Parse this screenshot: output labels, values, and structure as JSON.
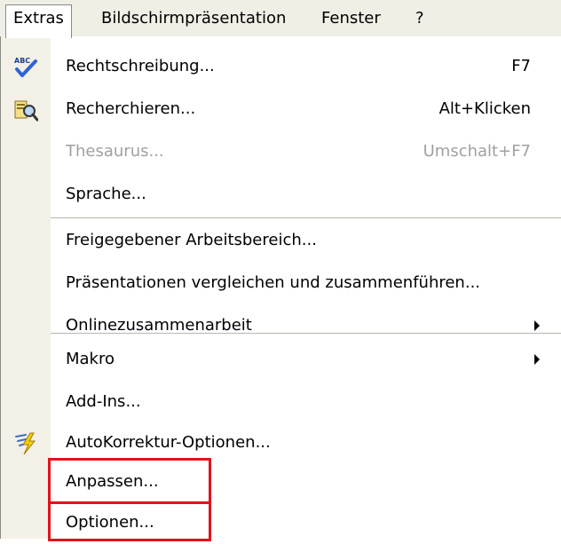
{
  "menubar": {
    "items": [
      {
        "label": "Extras",
        "active": true
      },
      {
        "label": "Bildschirmpräsentation"
      },
      {
        "label": "Fenster"
      },
      {
        "label": "?"
      }
    ]
  },
  "menu": {
    "items": [
      {
        "label": "Rechtschreibung...",
        "shortcut": "F7",
        "icon": "spelling-check-icon"
      },
      {
        "label": "Recherchieren...",
        "shortcut": "Alt+Klicken",
        "icon": "research-icon"
      },
      {
        "label": "Thesaurus...",
        "shortcut": "Umschalt+F7",
        "disabled": true
      },
      {
        "label": "Sprache..."
      },
      {
        "label": "Freigegebener Arbeitsbereich..."
      },
      {
        "label": "Präsentationen vergleichen und zusammenführen..."
      },
      {
        "label": "Onlinezusammenarbeit",
        "submenu": true
      },
      {
        "label": "Makro",
        "submenu": true
      },
      {
        "label": "Add-Ins..."
      },
      {
        "label": "AutoKorrektur-Optionen...",
        "icon": "autocorrect-lightning-icon"
      },
      {
        "label": "Anpassen..."
      },
      {
        "label": "Optionen..."
      }
    ]
  },
  "colors": {
    "menubar_bg": "#f0efe6",
    "icon_column_bg": "#f3f1e7",
    "disabled_text": "#a0a0a0",
    "highlight": "#e0141b"
  }
}
